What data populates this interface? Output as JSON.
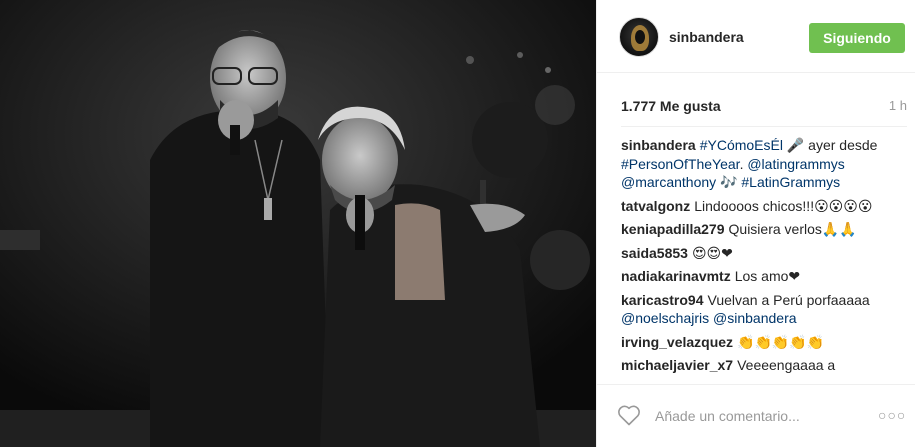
{
  "post": {
    "author": "sinbandera",
    "follow_label": "Siguiendo",
    "likes": "1.777 Me gusta",
    "time": "1 h",
    "caption": {
      "user": "sinbandera",
      "parts": [
        {
          "t": "#YCómoEsÉl",
          "tag": true
        },
        {
          "t": " 🎤 ayer desde ",
          "tag": false
        },
        {
          "t": "#PersonOfTheYear",
          "tag": true
        },
        {
          "t": ". ",
          "tag": false
        },
        {
          "t": "@latingrammys",
          "tag": true
        },
        {
          "t": " ",
          "tag": false
        },
        {
          "t": "@marcanthony",
          "tag": true
        },
        {
          "t": " 🎶 ",
          "tag": false
        },
        {
          "t": "#LatinGrammys",
          "tag": true
        }
      ]
    },
    "comments": [
      {
        "user": "tatvalgonz",
        "parts": [
          {
            "t": "Lindoooos chicos!!!😮😮😮😮",
            "tag": false
          }
        ]
      },
      {
        "user": "keniapadilla279",
        "parts": [
          {
            "t": "Quisiera verlos🙏🙏",
            "tag": false
          }
        ]
      },
      {
        "user": "saida5853",
        "parts": [
          {
            "t": "😍😍❤",
            "tag": false
          }
        ]
      },
      {
        "user": "nadiakarinavmtz",
        "parts": [
          {
            "t": "Los amo❤",
            "tag": false
          }
        ]
      },
      {
        "user": "karicastro94",
        "parts": [
          {
            "t": "Vuelvan a Perú porfaaaaa ",
            "tag": false
          },
          {
            "t": "@noelschajris",
            "tag": true
          },
          {
            "t": " ",
            "tag": false
          },
          {
            "t": "@sinbandera",
            "tag": true
          }
        ]
      },
      {
        "user": "irving_velazquez",
        "parts": [
          {
            "t": "👏👏👏👏👏",
            "tag": false
          }
        ]
      },
      {
        "user": "michaeljavier_x7",
        "parts": [
          {
            "t": "Veeeengaaaa a",
            "tag": false
          }
        ]
      }
    ],
    "add_comment_placeholder": "Añade un comentario...",
    "more_label": "○○○"
  },
  "icons": {
    "like": "heart-outline-icon",
    "options": "more-options-icon"
  },
  "colors": {
    "follow_button": "#70c050",
    "link": "#003569",
    "muted": "#999999"
  }
}
